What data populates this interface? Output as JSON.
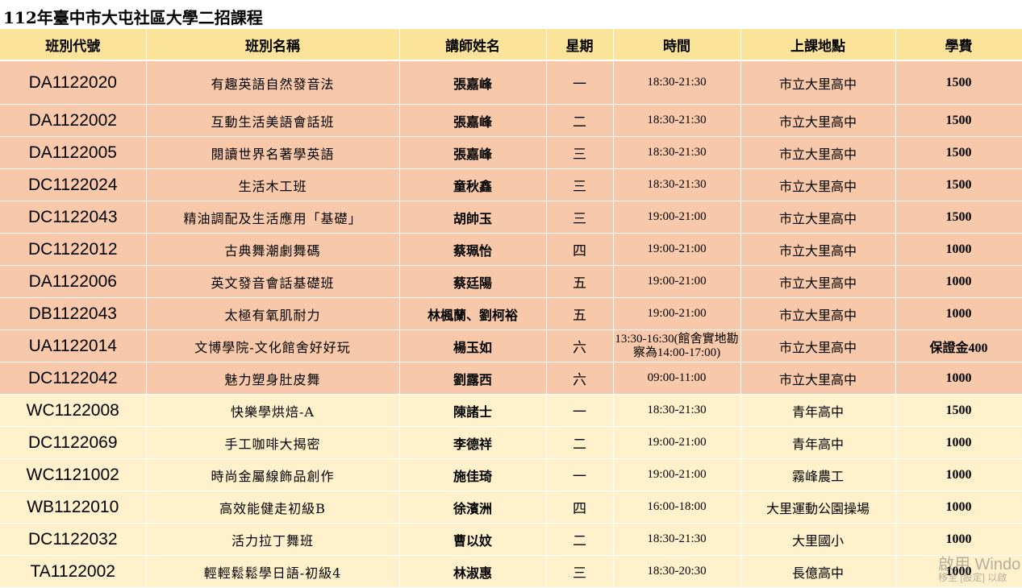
{
  "title": "112年臺中市大屯社區大學二招課程",
  "headers": [
    "班別代號",
    "班別名稱",
    "講師姓名",
    "星期",
    "時間",
    "上課地點",
    "學費"
  ],
  "rows": [
    {
      "code": "DA1122020",
      "name": "有趣英語自然發音法",
      "teacher": "張嘉峰",
      "day": "一",
      "time": "18:30-21:30",
      "place": "市立大里高中",
      "fee": "1500"
    },
    {
      "code": "DA1122002",
      "name": "互動生活美語會話班",
      "teacher": "張嘉峰",
      "day": "二",
      "time": "18:30-21:30",
      "place": "市立大里高中",
      "fee": "1500"
    },
    {
      "code": "DA1122005",
      "name": "閱讀世界名著學英語",
      "teacher": "張嘉峰",
      "day": "三",
      "time": "18:30-21:30",
      "place": "市立大里高中",
      "fee": "1500"
    },
    {
      "code": "DC1122024",
      "name": "生活木工班",
      "teacher": "童秋鑫",
      "day": "三",
      "time": "18:30-21:30",
      "place": "市立大里高中",
      "fee": "1500"
    },
    {
      "code": "DC1122043",
      "name": "精油調配及生活應用「基礎」",
      "teacher": "胡帥玉",
      "day": "三",
      "time": "19:00-21:00",
      "place": "市立大里高中",
      "fee": "1500"
    },
    {
      "code": "DC1122012",
      "name": "古典舞潮劇舞碼",
      "teacher": "蔡珮怡",
      "day": "四",
      "time": "19:00-21:00",
      "place": "市立大里高中",
      "fee": "1000"
    },
    {
      "code": "DA1122006",
      "name": "英文發音會話基礎班",
      "teacher": "蔡廷陽",
      "day": "五",
      "time": "19:00-21:00",
      "place": "市立大里高中",
      "fee": "1000"
    },
    {
      "code": "DB1122043",
      "name": "太極有氧肌耐力",
      "teacher": "林楓蘭、劉柯裕",
      "day": "五",
      "time": "19:00-21:00",
      "place": "市立大里高中",
      "fee": "1000"
    },
    {
      "code": "UA1122014",
      "name": "文博學院-文化館舍好好玩",
      "teacher": "楊玉如",
      "day": "六",
      "time": "13:30-16:30(館舍實地勘察為14:00-17:00)",
      "place": "市立大里高中",
      "fee": "保證金400"
    },
    {
      "code": "DC1122042",
      "name": "魅力塑身肚皮舞",
      "teacher": "劉露西",
      "day": "六",
      "time": "09:00-11:00",
      "place": "市立大里高中",
      "fee": "1000"
    },
    {
      "code": "WC1122008",
      "name": "快樂學烘焙-A",
      "teacher": "陳諸士",
      "day": "一",
      "time": "18:30-21:30",
      "place": "青年高中",
      "fee": "1500"
    },
    {
      "code": "DC1122069",
      "name": "手工咖啡大揭密",
      "teacher": "李德祥",
      "day": "二",
      "time": "19:00-21:00",
      "place": "青年高中",
      "fee": "1000"
    },
    {
      "code": "WC1121002",
      "name": "時尚金屬線飾品創作",
      "teacher": "施佳琦",
      "day": "一",
      "time": "19:00-21:00",
      "place": "霧峰農工",
      "fee": "1000"
    },
    {
      "code": "WB1122010",
      "name": "高效能健走初級B",
      "teacher": "徐濱洲",
      "day": "四",
      "time": "16:00-18:00",
      "place": "大里運動公園操場",
      "fee": "1000"
    },
    {
      "code": "DC1122032",
      "name": "活力拉丁舞班",
      "teacher": "曹以妏",
      "day": "二",
      "time": "18:30-21:30",
      "place": "大里國小",
      "fee": "1000"
    },
    {
      "code": "TA1122002",
      "name": "輕輕鬆鬆學日語-初級4",
      "teacher": "林淑惠",
      "day": "三",
      "time": "18:30-20:30",
      "place": "長億高中",
      "fee": "1000"
    }
  ],
  "watermark": {
    "line1": "啟用 Windo",
    "line2": "移至 [設定] 以啟"
  },
  "colors": {
    "header": "#fce39a",
    "group_a": "#f7c9aa",
    "group_b": "#fff1cc"
  }
}
